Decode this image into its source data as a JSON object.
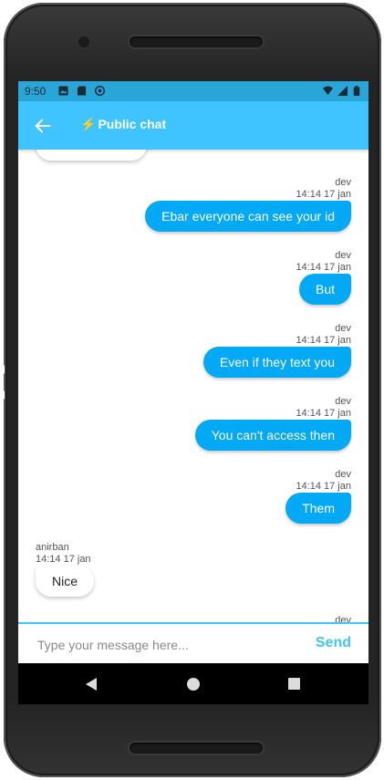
{
  "status_bar": {
    "time": "9:50"
  },
  "app_bar": {
    "title": "Public chat"
  },
  "messages": [
    {
      "author": "dev",
      "time": "14:14 17 jan",
      "text": "Ebar everyone can see your id",
      "direction": "out"
    },
    {
      "author": "dev",
      "time": "14:14 17 jan",
      "text": "But",
      "direction": "out"
    },
    {
      "author": "dev",
      "time": "14:14 17 jan",
      "text": "Even if they text you",
      "direction": "out"
    },
    {
      "author": "dev",
      "time": "14:14 17 jan",
      "text": "You can't access then",
      "direction": "out"
    },
    {
      "author": "dev",
      "time": "14:14 17 jan",
      "text": "Them",
      "direction": "out"
    },
    {
      "author": "anirban",
      "time": "14:14 17 jan",
      "text": "Nice",
      "direction": "in"
    }
  ],
  "composer": {
    "placeholder": "Type your message here...",
    "send_label": "Send"
  },
  "colors": {
    "app_bar": "#40c4ff",
    "status_bar": "#29a5d8",
    "outgoing_bubble": "#03a9f4",
    "bolt": "#ffd600"
  }
}
